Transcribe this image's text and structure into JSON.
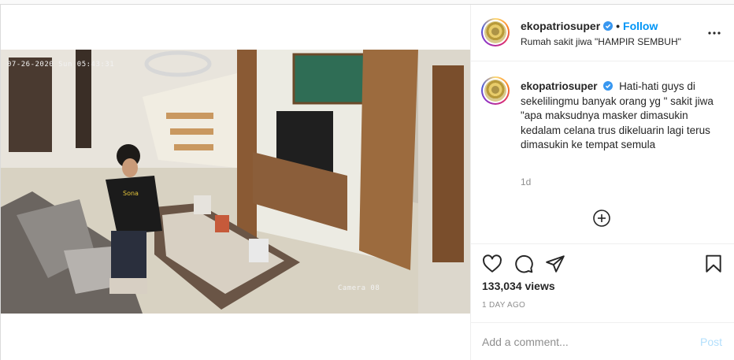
{
  "post": {
    "username": "ekopatriosuper",
    "follow_label": "Follow",
    "dot": "•",
    "location_subtitle": "Rumah sakit jiwa \"HAMPIR SEMBUH\"",
    "caption_username": "ekopatriosuper",
    "caption_text": "Hati-hati guys di sekelilingmu banyak orang yg \" sakit jiwa \"apa maksudnya masker dimasukin kedalam celana trus dikeluarin lagi terus dimasukin ke tempat semula",
    "time_ago": "1d",
    "views": "133,034 views",
    "date": "1 DAY AGO"
  },
  "video": {
    "timestamp": "07-26-2020 Sun 05:43:31",
    "camera_label": "Camera 08"
  },
  "comment_box": {
    "placeholder": "Add a comment...",
    "post_label": "Post"
  },
  "icons": {
    "verified": "verified-badge-icon",
    "more": "more-options-icon",
    "load_more": "plus-circle-icon",
    "like": "heart-icon",
    "comment": "comment-icon",
    "share": "paper-plane-icon",
    "save": "bookmark-icon"
  },
  "colors": {
    "accent": "#0095f6",
    "post_disabled": "#b2dffc",
    "muted": "#8e8e8e",
    "text": "#262626"
  }
}
